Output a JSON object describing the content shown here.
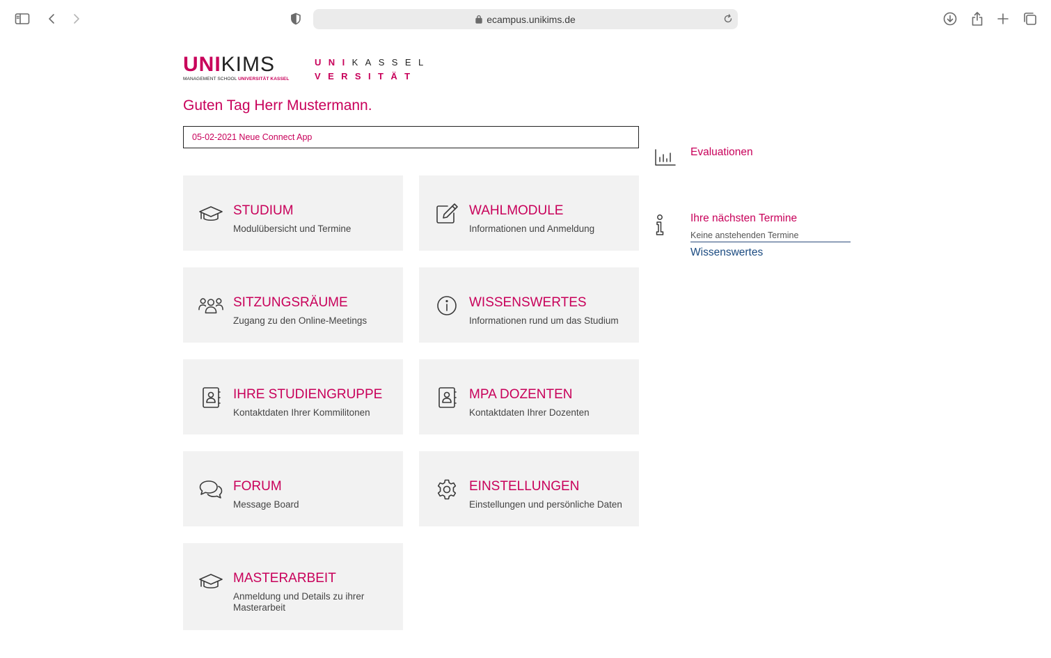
{
  "browser": {
    "url": "ecampus.unikims.de"
  },
  "logos": {
    "unikims_uni": "UNI",
    "unikims_kims": "KIMS",
    "unikims_sub_plain": "MANAGEMENT SCHOOL",
    "unikims_sub_accent": "UNIVERSITÄT KASSEL",
    "kassel_line1_pink": "UNI",
    "kassel_line1_dark": "KASSEL",
    "kassel_line2": "VERSITÄT"
  },
  "greeting": "Guten Tag Herr Mustermann.",
  "news": "05-02-2021 Neue Connect App",
  "tiles": [
    {
      "title": "STUDIUM",
      "subtitle": "Modulübersicht und Termine",
      "icon": "graduation-cap-icon"
    },
    {
      "title": "WAHLMODULE",
      "subtitle": "Informationen und Anmeldung",
      "icon": "edit-icon"
    },
    {
      "title": "SITZUNGSRÄUME",
      "subtitle": "Zugang zu den Online-Meetings",
      "icon": "users-icon"
    },
    {
      "title": "WISSENSWERTES",
      "subtitle": "Informationen rund um das Studium",
      "icon": "info-icon"
    },
    {
      "title": "IHRE STUDIENGRUPPE",
      "subtitle": "Kontaktdaten Ihrer Kommilitonen",
      "icon": "contact-book-icon"
    },
    {
      "title": "MPA DOZENTEN",
      "subtitle": "Kontaktdaten Ihrer Dozenten",
      "icon": "contact-book-icon"
    },
    {
      "title": "FORUM",
      "subtitle": "Message Board",
      "icon": "chat-bubbles-icon"
    },
    {
      "title": "EINSTELLUNGEN",
      "subtitle": "Einstellungen und persönliche Daten",
      "icon": "gear-icon"
    },
    {
      "title": "MASTERARBEIT",
      "subtitle": "Anmeldung und Details zu ihrer Masterarbeit",
      "icon": "graduation-cap-icon"
    }
  ],
  "sidebar": {
    "evaluationen": "Evaluationen",
    "termine_title": "Ihre nächsten Termine",
    "termine_empty": "Keine anstehenden Termine",
    "wissenswertes": "Wissenswertes"
  },
  "colors": {
    "accent": "#c8005a",
    "tile_bg": "#f2f2f2",
    "link_blue": "#1a4a80"
  }
}
